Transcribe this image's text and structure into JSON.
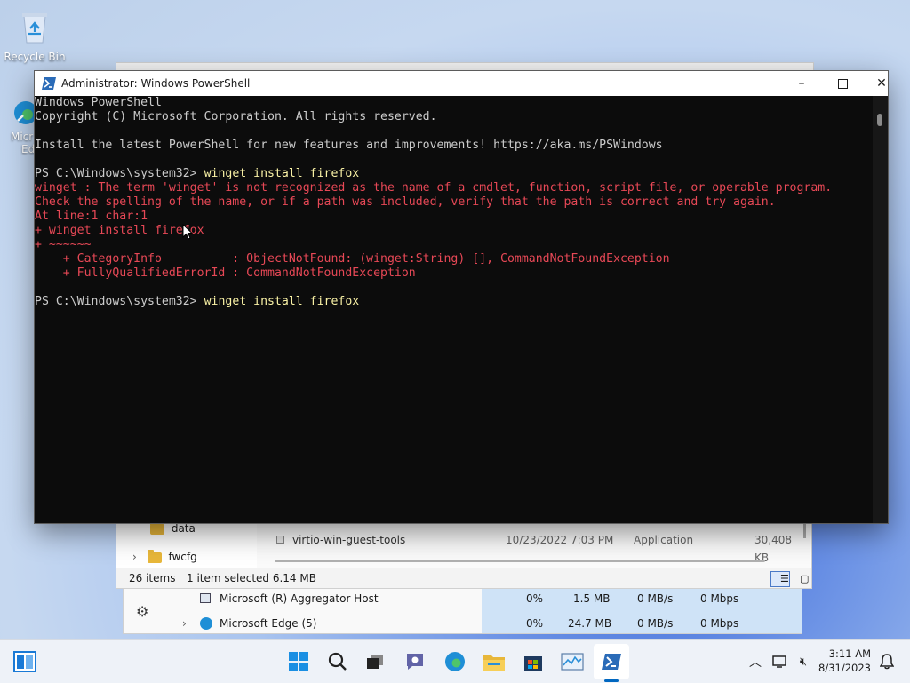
{
  "desktop": {
    "recycle_bin_label": "Recycle Bin",
    "edge_label_line1": "Micr",
    "edge_label_line2": "Ed"
  },
  "powershell": {
    "title": "Administrator: Windows PowerShell",
    "lines": [
      {
        "text": "Windows PowerShell",
        "style": "normal"
      },
      {
        "text": "Copyright (C) Microsoft Corporation. All rights reserved.",
        "style": "normal"
      },
      {
        "text": "",
        "style": "normal"
      },
      {
        "text": "Install the latest PowerShell for new features and improvements! https://aka.ms/PSWindows",
        "style": "normal"
      },
      {
        "text": "",
        "style": "normal"
      },
      {
        "prompt": "PS C:\\Windows\\system32> ",
        "command": "winget install firefox",
        "style": "cmdline"
      },
      {
        "text": "winget : The term 'winget' is not recognized as the name of a cmdlet, function, script file, or operable program.",
        "style": "err"
      },
      {
        "text": "Check the spelling of the name, or if a path was included, verify that the path is correct and try again.",
        "style": "err"
      },
      {
        "text": "At line:1 char:1",
        "style": "err"
      },
      {
        "text": "+ winget install firefox",
        "style": "err"
      },
      {
        "text": "+ ~~~~~~",
        "style": "err"
      },
      {
        "text": "    + CategoryInfo          : ObjectNotFound: (winget:String) [], CommandNotFoundException",
        "style": "err"
      },
      {
        "text": "    + FullyQualifiedErrorId : CommandNotFoundException",
        "style": "err"
      },
      {
        "text": "",
        "style": "normal"
      },
      {
        "prompt": "PS C:\\Windows\\system32> ",
        "command": "winget install firefox",
        "style": "cmdline"
      }
    ]
  },
  "explorer": {
    "nav_items": [
      {
        "label": "data"
      },
      {
        "label": "fwcfg"
      }
    ],
    "file": {
      "name": "virtio-win-guest-tools",
      "date": "10/23/2022 7:03 PM",
      "type": "Application",
      "size": "30,408 KB"
    },
    "status": {
      "items": "26 items",
      "selected": "1 item selected  6.14 MB"
    }
  },
  "task_manager": {
    "rows": [
      {
        "name": "Microsoft (R) Aggregator Host",
        "cpu": "0%",
        "memory": "1.5 MB",
        "disk": "0 MB/s",
        "network": "0 Mbps"
      },
      {
        "name": "Microsoft Edge (5)",
        "cpu": "0%",
        "memory": "24.7 MB",
        "disk": "0 MB/s",
        "network": "0 Mbps"
      }
    ]
  },
  "taskbar": {
    "time": "3:11 AM",
    "date": "8/31/2023"
  },
  "colors": {
    "console_bg": "#0c0c0c",
    "console_fg": "#cccccc",
    "error": "#e74856",
    "command": "#f9f1a5",
    "accent": "#0067c0"
  }
}
